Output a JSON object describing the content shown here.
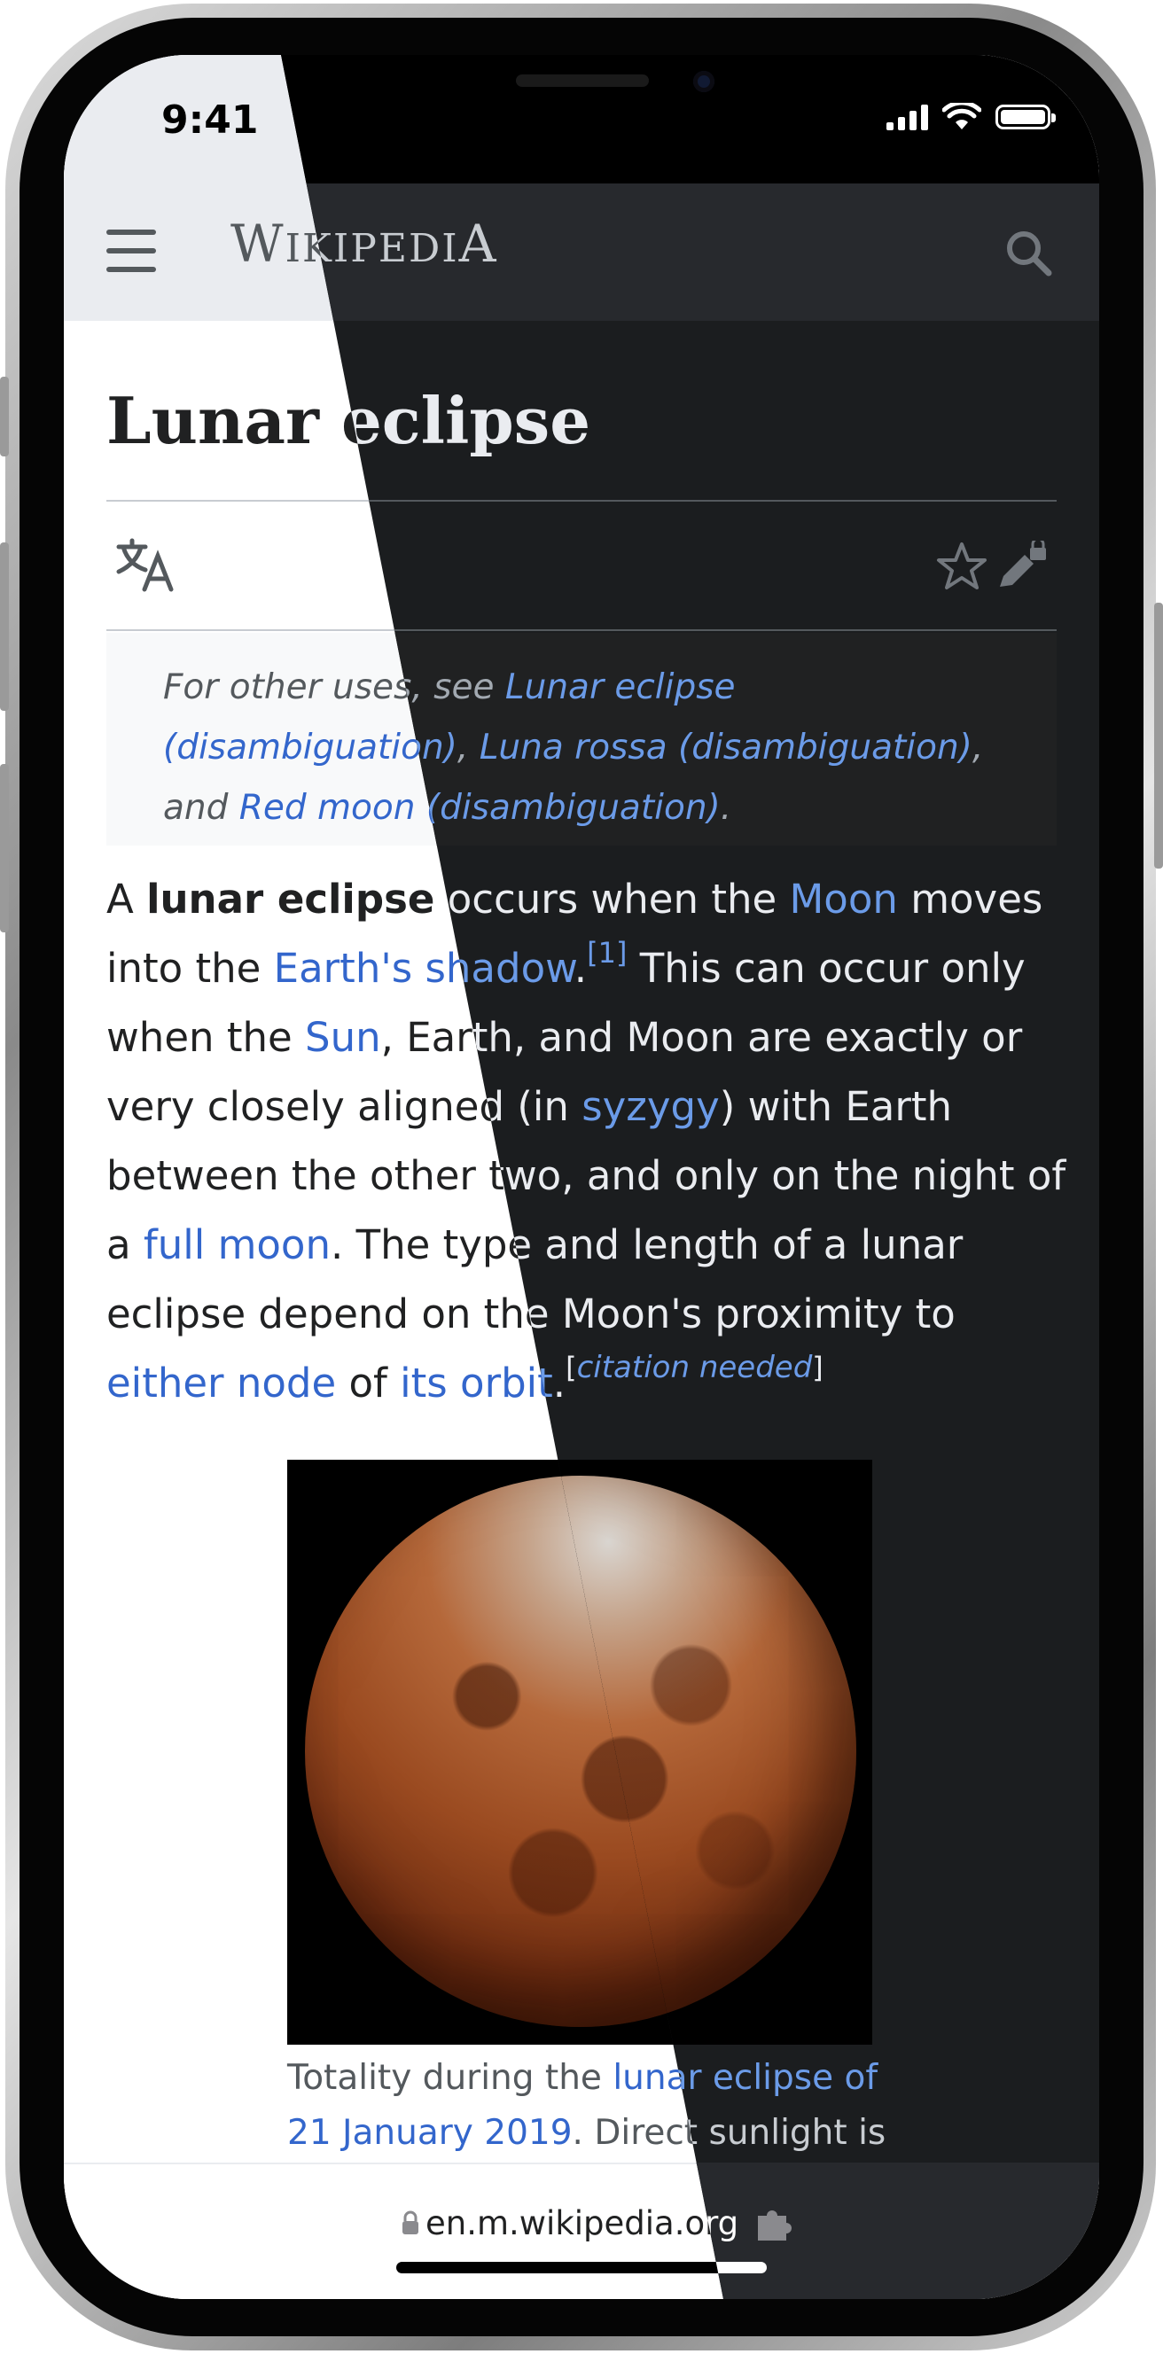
{
  "status_bar": {
    "time": "9:41"
  },
  "header": {
    "wordmark": "Wikipedia",
    "wordmark_parts": [
      "W",
      "IKIPEDI",
      "A"
    ]
  },
  "article": {
    "title": "Lunar eclipse",
    "hatnote": {
      "prefix": "For other uses, see ",
      "link1": "Lunar eclipse (disambiguation)",
      "sep1": ", ",
      "link2": "Luna rossa (disambiguation)",
      "sep2": ", and ",
      "link3": "Red moon (disambiguation)",
      "suffix": "."
    },
    "intro": {
      "t1": "A ",
      "bold": "lunar eclipse",
      "t2": " occurs when the ",
      "link_moon": "Moon",
      "t3": " moves into the ",
      "link_shadow": "Earth's shadow",
      "t4": ".",
      "ref1": "[1]",
      "t5": " This can occur only when the ",
      "link_sun": "Sun",
      "t6": ", Earth, and Moon are exactly or very closely aligned (in ",
      "link_syzygy": "syzygy",
      "t7": ") with Earth between the other two, and only on the night of a ",
      "link_fullmoon": "full moon",
      "t8": ". The type and length of a lunar eclipse depend on the Moon's proximity to ",
      "link_node": "either node",
      "t9": " of ",
      "link_orbit": "its orbit",
      "t10": ".",
      "cite_open": "[",
      "cite_text": "citation needed",
      "cite_close": "]"
    },
    "image_caption": {
      "t1": "Totality during the ",
      "link": "lunar eclipse of 21 January 2019",
      "t2": ". Direct sunlight is"
    }
  },
  "bottom_bar": {
    "url": "en.m.wikipedia.org"
  }
}
